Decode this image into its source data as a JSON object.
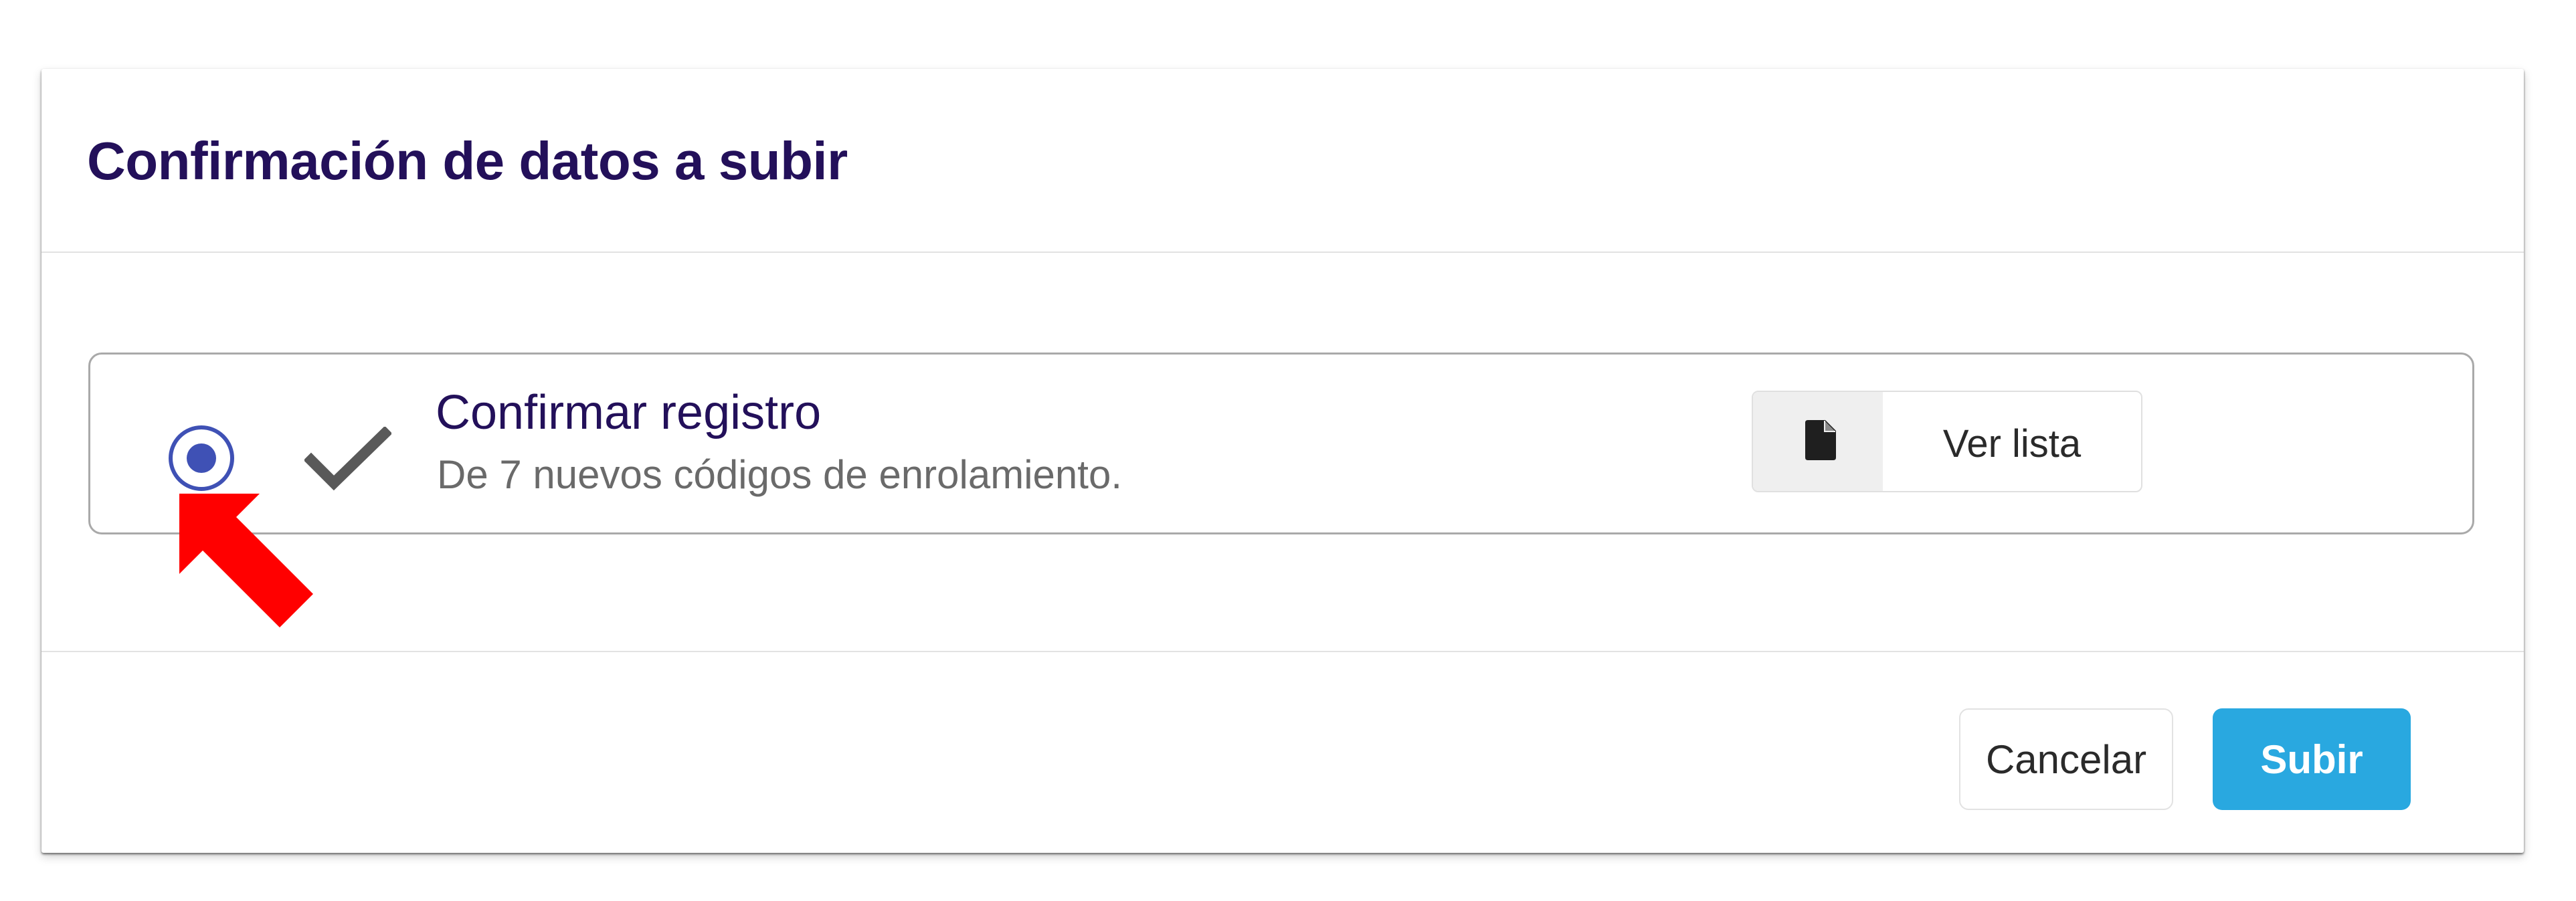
{
  "dialog": {
    "title": "Confirmación de datos a subir"
  },
  "option": {
    "selected": true,
    "status_icon": "check-icon",
    "title": "Confirmar registro",
    "subtitle": "De 7 nuevos códigos de enrolamiento.",
    "view_list": {
      "icon": "file-icon",
      "label": "Ver lista"
    }
  },
  "footer": {
    "cancel_label": "Cancelar",
    "submit_label": "Subir"
  },
  "annotation": {
    "icon": "red-arrow-icon",
    "color": "#ff0000"
  },
  "colors": {
    "title": "#23105a",
    "radio": "#3f51b5",
    "submit_button": "#29a8e0"
  }
}
